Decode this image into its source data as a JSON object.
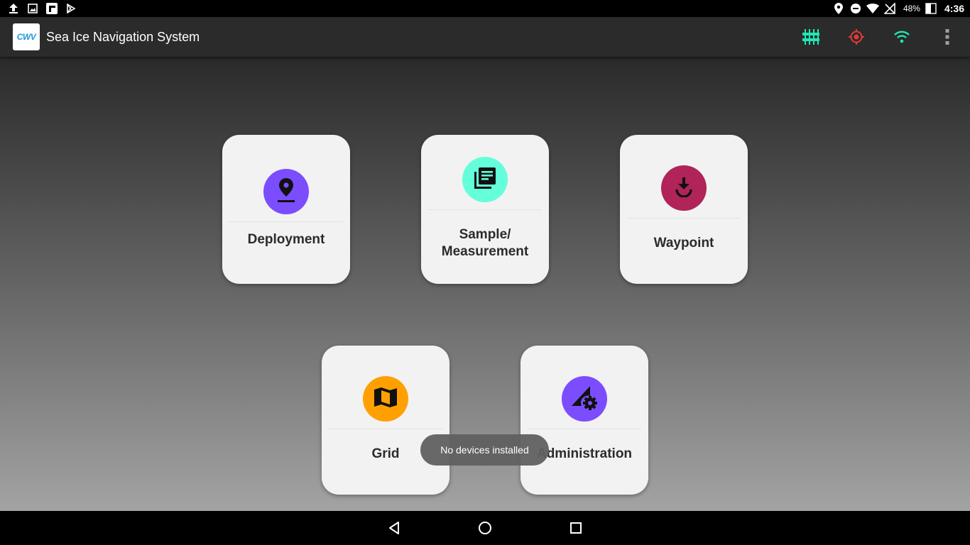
{
  "status_bar": {
    "left_icons": [
      "upload-icon",
      "image-icon",
      "flipboard-icon",
      "play-store-icon"
    ],
    "right_icons": [
      "location-icon",
      "do-not-disturb-icon",
      "wifi-icon",
      "no-signal-icon"
    ],
    "battery": "48%",
    "time": "4:36"
  },
  "app_bar": {
    "logo_text": "CWV",
    "title": "Sea Ice Navigation System",
    "actions": [
      "device-status-icon",
      "gps-target-icon",
      "wifi-icon",
      "overflow-menu-icon"
    ]
  },
  "tiles": [
    {
      "id": "deployment",
      "label": "Deployment",
      "icon": "location-pin-icon",
      "color": "#7c4dff"
    },
    {
      "id": "sample",
      "label": "Sample/\nMeasurement",
      "icon": "library-books-icon",
      "color": "#64ffda"
    },
    {
      "id": "waypoint",
      "label": "Waypoint",
      "icon": "download-anchor-icon",
      "color": "#b0245a"
    },
    {
      "id": "grid",
      "label": "Grid",
      "icon": "map-icon",
      "color": "#ffa000"
    },
    {
      "id": "administration",
      "label": "Administration",
      "icon": "network-settings-icon",
      "color": "#7c4dff"
    }
  ],
  "toast": {
    "text": "No devices installed"
  },
  "nav_bar": {
    "buttons": [
      "back-icon",
      "home-icon",
      "recents-icon"
    ]
  },
  "colors": {
    "accent_teal": "#1de9b6",
    "alert_red": "#e53935"
  }
}
